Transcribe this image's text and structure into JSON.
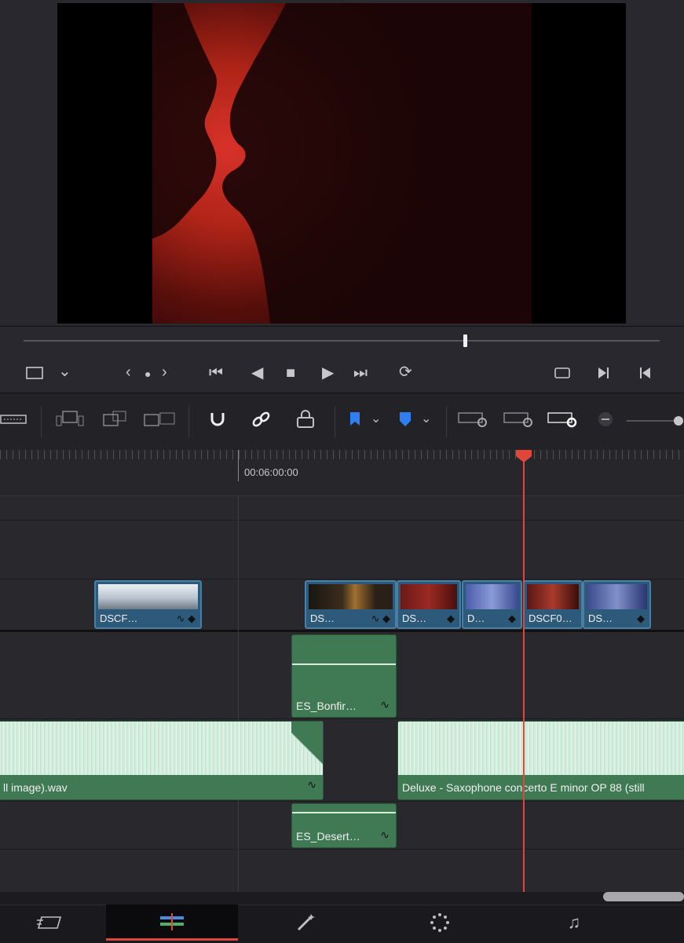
{
  "viewer": {
    "controls": {
      "crop_icon": "crop-icon",
      "chevron": "⌄",
      "prev_frame": "‹",
      "dot": "●",
      "next_frame": "›",
      "go_start": "⏮",
      "play_reverse": "◀",
      "stop": "■",
      "play": "▶",
      "go_end": "⏭",
      "loop": "⟳"
    },
    "playhead_fraction": 0.694
  },
  "timeline": {
    "timecode": "00:06:00:00",
    "video_clips": [
      {
        "label": "DSCF…",
        "tone": "snow"
      },
      {
        "label": "DS…",
        "tone": "night"
      },
      {
        "label": "DS…",
        "tone": "red"
      },
      {
        "label": "D…",
        "tone": "blue"
      },
      {
        "label": "DSCF0…",
        "tone": "red"
      },
      {
        "label": "DS…",
        "tone": "blue"
      }
    ],
    "audio_clips": [
      {
        "label": "ES_Bonfir…"
      },
      {
        "label": "ll image).wav"
      },
      {
        "label": "Deluxe - Saxophone concerto E minor OP 88 (still"
      },
      {
        "label": "ES_Desert…"
      }
    ]
  },
  "bottom_nav": {
    "items": [
      {
        "name": "cut-page"
      },
      {
        "name": "edit-page",
        "active": true
      },
      {
        "name": "fusion-page"
      },
      {
        "name": "color-page"
      },
      {
        "name": "fairlight-page"
      }
    ]
  },
  "colors": {
    "playhead": "#e0473a",
    "video_clip": "#2d5a7a",
    "audio_clip": "#3f7a55",
    "active_tab": "#e0473a"
  }
}
